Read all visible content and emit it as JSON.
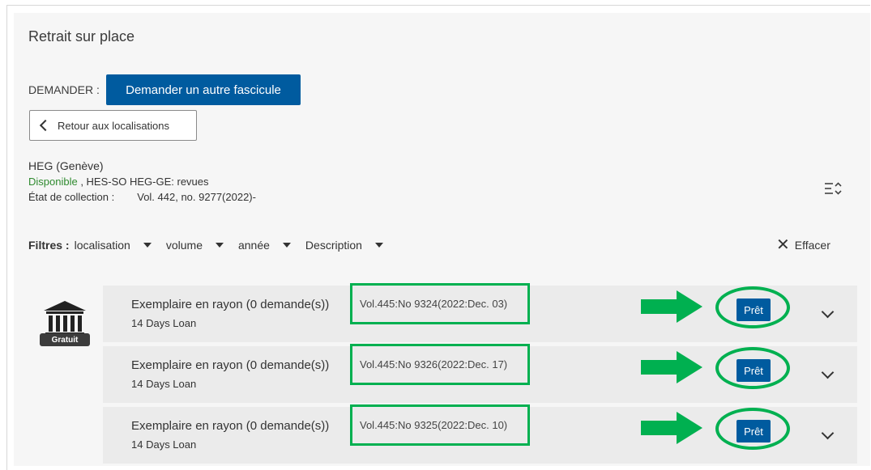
{
  "section_title": "Retrait sur place",
  "request": {
    "label": "DEMANDER :",
    "button_label": "Demander un autre fascicule"
  },
  "back_button_label": "Retour aux localisations",
  "location": {
    "library": "HEG (Genève)",
    "status": "Disponible",
    "status_suffix": " , HES-SO HEG-GE: revues",
    "collection_label": "État de collection :",
    "collection_value": "Vol. 442, no. 9277(2022)-"
  },
  "filters": {
    "label": "Filtres :",
    "items": [
      "localisation",
      "volume",
      "année",
      "Description"
    ],
    "clear_label": "Effacer"
  },
  "badge_label": "Gratuit",
  "items": [
    {
      "title": "Exemplaire en rayon (0 demande(s))",
      "loan": "14 Days Loan",
      "description": "Vol.445:No 9324(2022:Dec. 03)",
      "action": "Prêt"
    },
    {
      "title": "Exemplaire en rayon (0 demande(s))",
      "loan": "14 Days Loan",
      "description": "Vol.445:No 9326(2022:Dec. 17)",
      "action": "Prêt"
    },
    {
      "title": "Exemplaire en rayon (0 demande(s))",
      "loan": "14 Days Loan",
      "description": "Vol.445:No 9325(2022:Dec. 10)",
      "action": "Prêt"
    }
  ],
  "colors": {
    "primary": "#005b9f",
    "available": "#2f8a2f",
    "annotation": "#00b050",
    "row_bg": "#ebebeb",
    "panel_bg": "#f6f6f6"
  },
  "icons": {
    "library": "library-building-icon",
    "sort": "sort-list-icon",
    "back": "chevron-left-icon",
    "clear": "close-icon",
    "expand": "chevron-down-icon",
    "annotation": "arrow-right-icon"
  }
}
